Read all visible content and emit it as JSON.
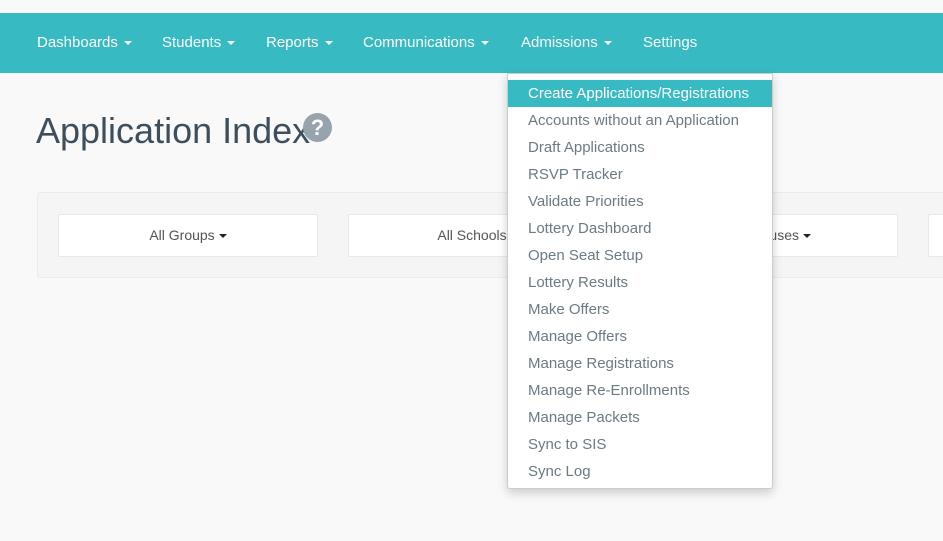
{
  "nav": {
    "items": [
      {
        "label": "Dashboards",
        "dropdown": true
      },
      {
        "label": "Students",
        "dropdown": true
      },
      {
        "label": "Reports",
        "dropdown": true
      },
      {
        "label": "Communications",
        "dropdown": true
      },
      {
        "label": "Admissions",
        "dropdown": true
      },
      {
        "label": "Settings",
        "dropdown": false
      }
    ],
    "color": "#37bac1"
  },
  "page": {
    "title": "Application Index",
    "help_icon": "question-circle-icon"
  },
  "filters": [
    {
      "label": "All Groups"
    },
    {
      "label": "All Schools"
    },
    {
      "label": "uses"
    }
  ],
  "admissions_menu": {
    "active_index": 0,
    "items": [
      "Create Applications/Registrations",
      "Accounts without an Application",
      "Draft Applications",
      "RSVP Tracker",
      "Validate Priorities",
      "Lottery Dashboard",
      "Open Seat Setup",
      "Lottery Results",
      "Make Offers",
      "Manage Offers",
      "Manage Registrations",
      "Manage Re-Enrollments",
      "Manage Packets",
      "Sync to SIS",
      "Sync Log"
    ]
  }
}
